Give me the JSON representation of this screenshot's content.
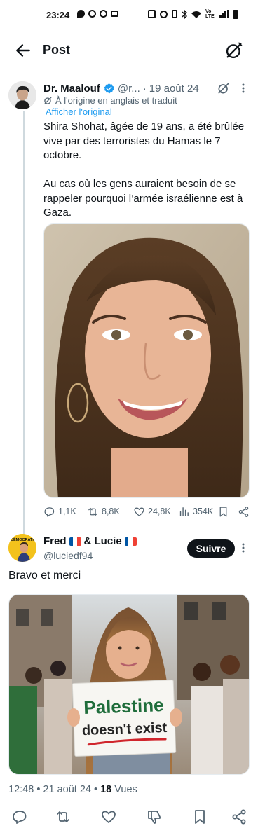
{
  "status_bar": {
    "time": "23:24",
    "network_label": "Vo LTE"
  },
  "header": {
    "title": "Post"
  },
  "tweet": {
    "author_name": "Dr. Maalouf",
    "handle": "@r...",
    "separator": "·",
    "date": "19 août 24",
    "translated_note": "À l'origine en anglais et traduit",
    "show_original": "Afficher l'original",
    "text": "Shira Shohat, âgée de 19 ans, a été brûlée vive par des terroristes du Hamas le 7 octobre.\n\nAu cas où les gens auraient besoin de se rappeler pourquoi l’armée israélienne est à Gaza.",
    "stats": {
      "replies": "1,1K",
      "reposts": "8,8K",
      "likes": "24,8K",
      "views": "354K"
    }
  },
  "reply": {
    "name_part1": "Fred",
    "name_part2": "& Lucie",
    "handle": "@luciedf94",
    "follow_label": "Suivre",
    "text": "Bravo et merci",
    "sign_line1": "Palestine",
    "sign_line2": "doesn't exist",
    "avatar_text": "DÉMOCRATIE"
  },
  "meta": {
    "time_date": "12:48 • 21 août 24 •",
    "views_count": "18",
    "views_label": "Vues"
  },
  "colors": {
    "accent_blue": "#1d9bf0",
    "text_primary": "#0f1419",
    "text_secondary": "#536471",
    "flag_blue": "#0055a4",
    "flag_red": "#ef4135"
  }
}
